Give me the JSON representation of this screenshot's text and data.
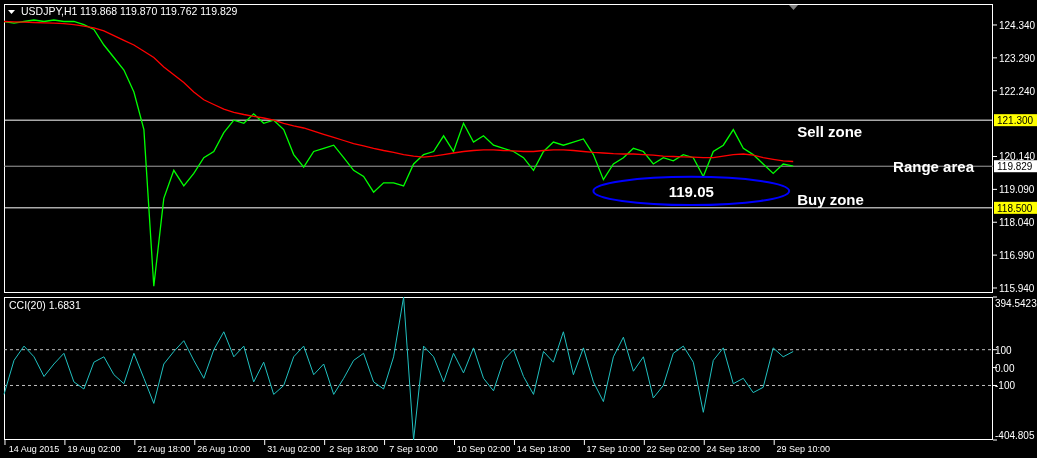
{
  "header": {
    "symbol": "USDJPY,H1",
    "quotes": [
      "119.868",
      "119.870",
      "119.762",
      "119.829"
    ]
  },
  "price_chart": {
    "chart_data": {
      "type": "line",
      "ylim": [
        115.78,
        125.01
      ],
      "yticks": [
        {
          "value": 124.34,
          "label": "124.340"
        },
        {
          "value": 123.29,
          "label": "123.290"
        },
        {
          "value": 122.24,
          "label": "122.240"
        },
        {
          "value": 120.14,
          "label": "120.140"
        },
        {
          "value": 119.09,
          "label": "119.090"
        },
        {
          "value": 118.04,
          "label": "118.040"
        },
        {
          "value": 116.99,
          "label": "116.990"
        },
        {
          "value": 115.94,
          "label": "115.940"
        }
      ],
      "series": [
        {
          "color": "#00ff00",
          "values": [
            124.45,
            124.4,
            124.45,
            124.5,
            124.45,
            124.5,
            124.45,
            124.45,
            124.35,
            124.2,
            123.7,
            123.3,
            122.9,
            122.2,
            121.0,
            116.0,
            118.8,
            119.7,
            119.2,
            119.6,
            120.1,
            120.3,
            120.9,
            121.3,
            121.2,
            121.5,
            121.2,
            121.3,
            121.0,
            120.2,
            119.8,
            120.3,
            120.4,
            120.5,
            120.1,
            119.7,
            119.5,
            119.0,
            119.3,
            119.3,
            119.2,
            119.9,
            120.2,
            120.3,
            120.8,
            120.3,
            121.2,
            120.6,
            120.8,
            120.5,
            120.4,
            120.3,
            120.1,
            119.7,
            120.3,
            120.6,
            120.5,
            120.6,
            120.7,
            120.2,
            119.4,
            119.9,
            120.1,
            120.4,
            120.3,
            119.9,
            120.1,
            120.0,
            120.2,
            120.1,
            119.5,
            120.3,
            120.5,
            121.0,
            120.4,
            120.2,
            119.9,
            119.6,
            119.9,
            119.83
          ]
        },
        {
          "color": "#ff0000",
          "values": [
            124.45,
            124.44,
            124.43,
            124.42,
            124.41,
            124.4,
            124.38,
            124.35,
            124.3,
            124.25,
            124.15,
            124.0,
            123.85,
            123.7,
            123.5,
            123.3,
            123.0,
            122.75,
            122.5,
            122.2,
            121.95,
            121.8,
            121.65,
            121.55,
            121.48,
            121.42,
            121.37,
            121.3,
            121.2,
            121.12,
            121.05,
            120.95,
            120.85,
            120.75,
            120.65,
            120.55,
            120.48,
            120.4,
            120.33,
            120.27,
            120.2,
            120.15,
            120.12,
            120.15,
            120.2,
            120.25,
            120.3,
            120.33,
            120.35,
            120.35,
            120.33,
            120.32,
            120.3,
            120.3,
            120.33,
            120.35,
            120.35,
            120.33,
            120.3,
            120.27,
            120.25,
            120.23,
            120.22,
            120.22,
            120.2,
            120.18,
            120.15,
            120.14,
            120.13,
            120.12,
            120.1,
            120.1,
            120.15,
            120.2,
            120.22,
            120.18,
            120.1,
            120.05,
            120.0,
            119.98
          ]
        }
      ],
      "ref_lines": [
        {
          "axis": "y",
          "value": 121.3,
          "label": "121.300"
        },
        {
          "axis": "y",
          "value": 119.829,
          "label": "119.829"
        },
        {
          "axis": "y",
          "value": 118.5,
          "label": "118.500"
        }
      ],
      "annotations": [
        "Sell zone",
        "Range area",
        "Buy zone",
        "119.05"
      ]
    }
  },
  "cci_chart": {
    "title": "CCI(20) 1.6831",
    "chart_data": {
      "type": "line",
      "categories": [
        null,
        null,
        null,
        "14 Aug 2015",
        null,
        null,
        null,
        null,
        null,
        "19 Aug 02:00",
        null,
        null,
        null,
        null,
        null,
        null,
        "21 Aug 18:00",
        null,
        null,
        null,
        null,
        null,
        "26 Aug 10:00",
        null,
        null,
        null,
        null,
        null,
        null,
        "31 Aug 02:00",
        null,
        null,
        null,
        null,
        null,
        "2 Sep 18:00",
        null,
        null,
        null,
        null,
        null,
        "7 Sep 10:00",
        null,
        null,
        null,
        null,
        null,
        null,
        "10 Sep 02:00",
        null,
        null,
        null,
        null,
        null,
        "14 Sep 18:00",
        null,
        null,
        null,
        null,
        null,
        null,
        "17 Sep 10:00",
        null,
        null,
        null,
        null,
        null,
        "22 Sep 02:00",
        null,
        null,
        null,
        null,
        null,
        "24 Sep 18:00",
        null,
        null,
        null,
        null,
        null,
        null,
        "29 Sep 10:00"
      ],
      "ylim": [
        -404.805,
        394.5423
      ],
      "yticks": [
        {
          "value": 394.5423,
          "label": "394.5423"
        },
        {
          "value": 100,
          "label": "100"
        },
        {
          "value": 0,
          "label": "0.00"
        },
        {
          "value": -100,
          "label": "-100"
        },
        {
          "value": -404.805,
          "label": "-404.805"
        }
      ],
      "series": [
        {
          "color": "#20c0c0",
          "values": [
            -150,
            40,
            120,
            60,
            -50,
            20,
            80,
            -80,
            -120,
            30,
            60,
            -40,
            -90,
            80,
            -60,
            -200,
            20,
            90,
            150,
            40,
            -60,
            100,
            200,
            60,
            120,
            -80,
            30,
            -150,
            -100,
            60,
            120,
            -40,
            20,
            -150,
            -60,
            40,
            80,
            -80,
            -120,
            60,
            394,
            -404,
            120,
            60,
            -80,
            80,
            -30,
            110,
            -60,
            -130,
            40,
            100,
            -50,
            -150,
            90,
            30,
            200,
            -40,
            110,
            -80,
            -190,
            60,
            170,
            -20,
            60,
            -170,
            -100,
            80,
            120,
            30,
            -250,
            40,
            110,
            -90,
            -60,
            -140,
            -110,
            110,
            60,
            90,
            null
          ]
        }
      ],
      "ref_lines": [
        {
          "axis": "y",
          "value": 100
        },
        {
          "axis": "y",
          "value": -100
        }
      ]
    }
  }
}
